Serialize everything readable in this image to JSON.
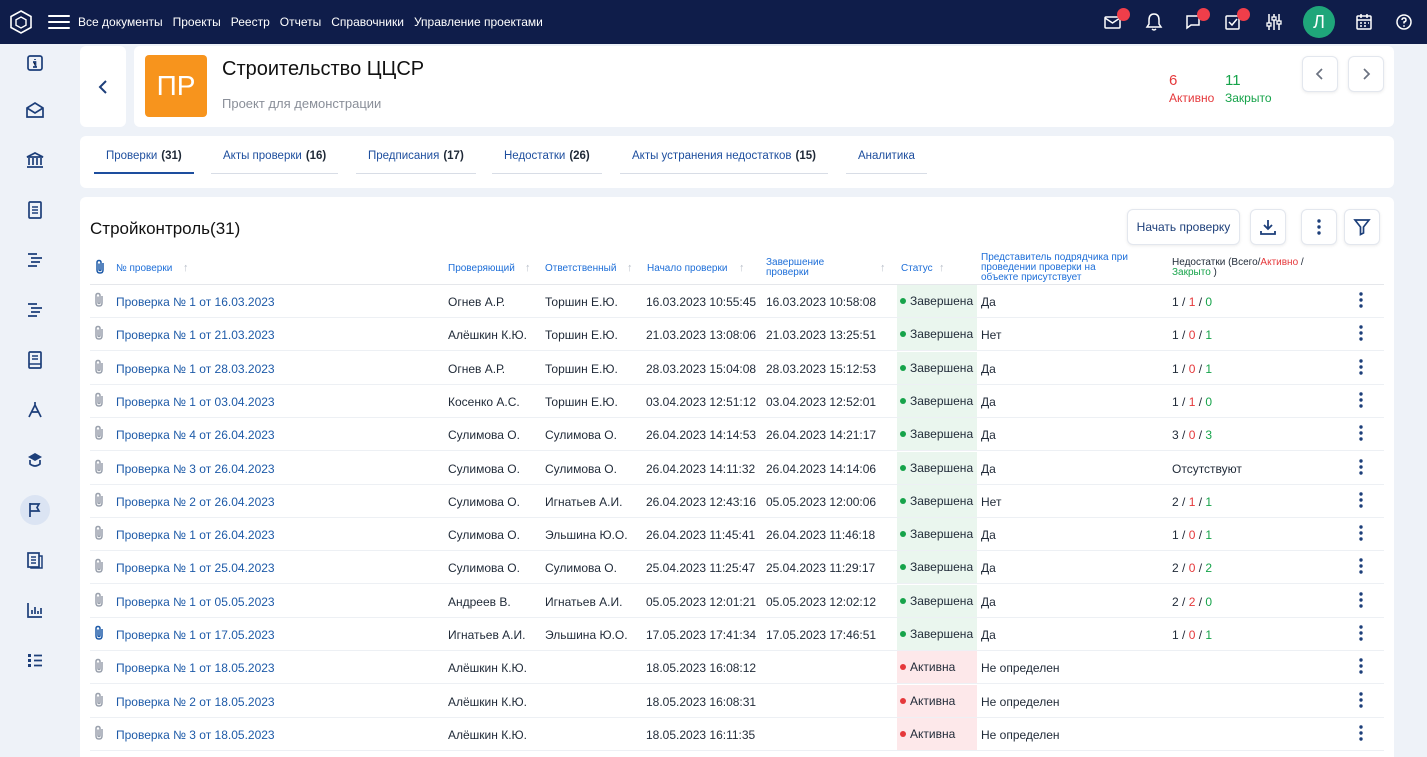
{
  "nav": {
    "items": [
      {
        "label": "Все документы"
      },
      {
        "label": "Проекты"
      },
      {
        "label": "Реестр"
      },
      {
        "label": "Отчеты"
      },
      {
        "label": "Справочники"
      },
      {
        "label": "Управление проектами"
      }
    ]
  },
  "user": {
    "initial": "Л",
    "avatar_color": "#1fa67a"
  },
  "project": {
    "logo": "ПР",
    "logo_color": "#f7941d",
    "title": "Строительство ЦЦСР",
    "subtitle": "Проект для демонстрации",
    "active_count": "6",
    "active_label": "Активно",
    "closed_count": "11",
    "closed_label": "Закрыто"
  },
  "tabs": [
    {
      "label": "Проверки",
      "count": "(31)"
    },
    {
      "label": "Акты проверки",
      "count": "(16)"
    },
    {
      "label": "Предписания",
      "count": "(17)"
    },
    {
      "label": "Недостатки",
      "count": "(26)"
    },
    {
      "label": "Акты устранения недостатков",
      "count": "(15)"
    },
    {
      "label": "Аналитика",
      "count": ""
    }
  ],
  "section": {
    "title": "Стройконтроль",
    "count": "(31)",
    "start_button": "Начать проверку"
  },
  "table": {
    "headers": {
      "number": "№ проверки",
      "inspector": "Проверяющий",
      "responsible": "Ответственный",
      "start": "Начало проверки",
      "end_1": "Завершение",
      "end_2": "проверки",
      "status": "Статус",
      "rep_1": "Представитель подрядчика при",
      "rep_2": "проведении проверки на",
      "rep_3": "объекте присутствует",
      "def_1": "Недостатки (Всего/",
      "def_active": "Активно",
      "def_slash": " /",
      "def_closed": "Закрыто",
      "def_close": " )"
    },
    "rows": [
      {
        "title": "Проверка № 1 от 16.03.2023",
        "inspector": "Огнев А.Р.",
        "responsible": "Торшин Е.Ю.",
        "start": "16.03.2023 10:55:45",
        "end": "16.03.2023 10:58:08",
        "status": "Завершена",
        "status_kind": "done",
        "rep": "Да",
        "def_total": "1",
        "def_active": "1",
        "def_closed": "0",
        "def_text": "",
        "clip_active": false
      },
      {
        "title": "Проверка № 1 от 21.03.2023",
        "inspector": "Алёшкин К.Ю.",
        "responsible": "Торшин Е.Ю.",
        "start": "21.03.2023 13:08:06",
        "end": "21.03.2023 13:25:51",
        "status": "Завершена",
        "status_kind": "done",
        "rep": "Нет",
        "def_total": "1",
        "def_active": "0",
        "def_closed": "1",
        "def_text": "",
        "clip_active": false
      },
      {
        "title": "Проверка № 1 от 28.03.2023",
        "inspector": "Огнев А.Р.",
        "responsible": "Торшин Е.Ю.",
        "start": "28.03.2023 15:04:08",
        "end": "28.03.2023 15:12:53",
        "status": "Завершена",
        "status_kind": "done",
        "rep": "Да",
        "def_total": "1",
        "def_active": "0",
        "def_closed": "1",
        "def_text": "",
        "clip_active": false
      },
      {
        "title": "Проверка № 1 от 03.04.2023",
        "inspector": "Косенко А.С.",
        "responsible": "Торшин Е.Ю.",
        "start": "03.04.2023 12:51:12",
        "end": "03.04.2023 12:52:01",
        "status": "Завершена",
        "status_kind": "done",
        "rep": "Да",
        "def_total": "1",
        "def_active": "1",
        "def_closed": "0",
        "def_text": "",
        "clip_active": false
      },
      {
        "title": "Проверка № 4 от 26.04.2023",
        "inspector": "Сулимова О.",
        "responsible": "Сулимова О.",
        "start": "26.04.2023 14:14:53",
        "end": "26.04.2023 14:21:17",
        "status": "Завершена",
        "status_kind": "done",
        "rep": "Да",
        "def_total": "3",
        "def_active": "0",
        "def_closed": "3",
        "def_text": "",
        "clip_active": false
      },
      {
        "title": "Проверка № 3 от 26.04.2023",
        "inspector": "Сулимова О.",
        "responsible": "Сулимова О.",
        "start": "26.04.2023 14:11:32",
        "end": "26.04.2023 14:14:06",
        "status": "Завершена",
        "status_kind": "done",
        "rep": "Да",
        "def_total": "",
        "def_active": "",
        "def_closed": "",
        "def_text": "Отсутствуют",
        "clip_active": false
      },
      {
        "title": "Проверка № 2 от 26.04.2023",
        "inspector": "Сулимова О.",
        "responsible": "Игнатьев А.И.",
        "start": "26.04.2023 12:43:16",
        "end": "05.05.2023 12:00:06",
        "status": "Завершена",
        "status_kind": "done",
        "rep": "Нет",
        "def_total": "2",
        "def_active": "1",
        "def_closed": "1",
        "def_text": "",
        "clip_active": false
      },
      {
        "title": "Проверка № 1 от 26.04.2023",
        "inspector": "Сулимова О.",
        "responsible": "Эльшина Ю.О.",
        "start": "26.04.2023 11:45:41",
        "end": "26.04.2023 11:46:18",
        "status": "Завершена",
        "status_kind": "done",
        "rep": "Да",
        "def_total": "1",
        "def_active": "0",
        "def_closed": "1",
        "def_text": "",
        "clip_active": false
      },
      {
        "title": "Проверка № 1 от 25.04.2023",
        "inspector": "Сулимова О.",
        "responsible": "Сулимова О.",
        "start": "25.04.2023 11:25:47",
        "end": "25.04.2023 11:29:17",
        "status": "Завершена",
        "status_kind": "done",
        "rep": "Да",
        "def_total": "2",
        "def_active": "0",
        "def_closed": "2",
        "def_text": "",
        "clip_active": false
      },
      {
        "title": "Проверка № 1 от 05.05.2023",
        "inspector": "Андреев В.",
        "responsible": "Игнатьев А.И.",
        "start": "05.05.2023 12:01:21",
        "end": "05.05.2023 12:02:12",
        "status": "Завершена",
        "status_kind": "done",
        "rep": "Да",
        "def_total": "2",
        "def_active": "2",
        "def_closed": "0",
        "def_text": "",
        "clip_active": false
      },
      {
        "title": "Проверка № 1 от 17.05.2023",
        "inspector": "Игнатьев А.И.",
        "responsible": "Эльшина Ю.О.",
        "start": "17.05.2023 17:41:34",
        "end": "17.05.2023 17:46:51",
        "status": "Завершена",
        "status_kind": "done",
        "rep": "Да",
        "def_total": "1",
        "def_active": "0",
        "def_closed": "1",
        "def_text": "",
        "clip_active": true
      },
      {
        "title": "Проверка № 1 от 18.05.2023",
        "inspector": "Алёшкин К.Ю.",
        "responsible": "",
        "start": "18.05.2023 16:08:12",
        "end": "",
        "status": "Активна",
        "status_kind": "act",
        "rep": "Не определен",
        "def_total": "",
        "def_active": "",
        "def_closed": "",
        "def_text": "",
        "clip_active": false
      },
      {
        "title": "Проверка № 2 от 18.05.2023",
        "inspector": "Алёшкин К.Ю.",
        "responsible": "",
        "start": "18.05.2023 16:08:31",
        "end": "",
        "status": "Активна",
        "status_kind": "act",
        "rep": "Не определен",
        "def_total": "",
        "def_active": "",
        "def_closed": "",
        "def_text": "",
        "clip_active": false
      },
      {
        "title": "Проверка № 3 от 18.05.2023",
        "inspector": "Алёшкин К.Ю.",
        "responsible": "",
        "start": "18.05.2023 16:11:35",
        "end": "",
        "status": "Активна",
        "status_kind": "act",
        "rep": "Не определен",
        "def_total": "",
        "def_active": "",
        "def_closed": "",
        "def_text": "",
        "clip_active": false
      }
    ]
  }
}
